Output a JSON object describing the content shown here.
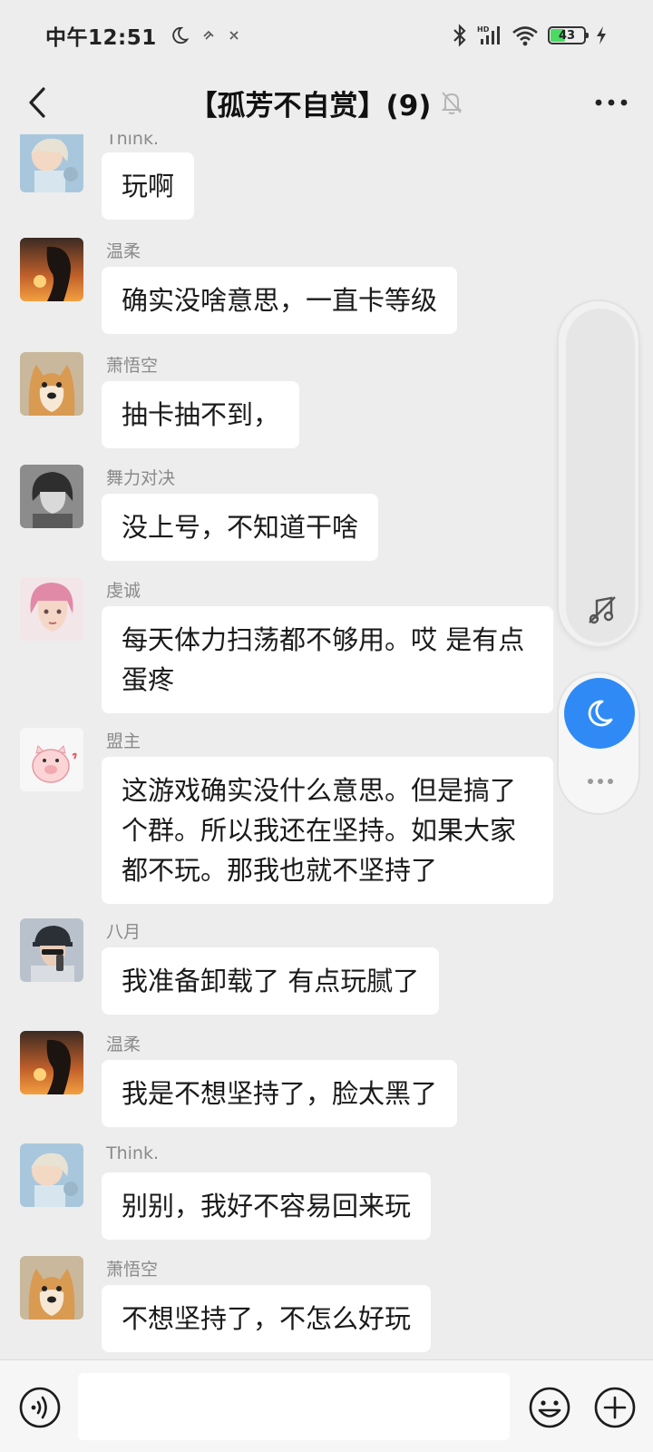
{
  "status_bar": {
    "time": "中午12:51",
    "battery": "43"
  },
  "nav": {
    "title": "【孤芳不自赏】(9)"
  },
  "messages": [
    {
      "sender": "Think.",
      "text": "玩啊",
      "avatar": "anime-girl-avatar"
    },
    {
      "sender": "温柔",
      "text": "确实没啥意思，一直卡等级",
      "avatar": "sunset-silhouette-avatar"
    },
    {
      "sender": "萧悟空",
      "text": "抽卡抽不到，",
      "avatar": "shiba-dog-avatar"
    },
    {
      "sender": "舞力对决",
      "text": "没上号，不知道干啥",
      "avatar": "grayscale-anime-avatar"
    },
    {
      "sender": "虔诚",
      "text": "每天体力扫荡都不够用。哎 是有点蛋疼",
      "avatar": "pink-hair-avatar"
    },
    {
      "sender": "盟主",
      "text": "这游戏确实没什么意思。但是搞了个群。所以我还在坚持。如果大家都不玩。那我也就不坚持了",
      "avatar": "pig-cartoon-avatar"
    },
    {
      "sender": "八月",
      "text": "我准备卸载了  有点玩腻了",
      "avatar": "cap-boy-avatar"
    },
    {
      "sender": "温柔",
      "text": "我是不想坚持了，脸太黑了",
      "avatar": "sunset-silhouette-avatar"
    },
    {
      "sender": "Think.",
      "text": "别别，我好不容易回来玩",
      "avatar": "anime-girl-avatar"
    },
    {
      "sender": "萧悟空",
      "text": "不想坚持了，不怎么好玩",
      "avatar": "shiba-dog-avatar"
    }
  ],
  "colors": {
    "background": "#ededed",
    "bubble": "#ffffff",
    "accent": "#2f8af5"
  }
}
